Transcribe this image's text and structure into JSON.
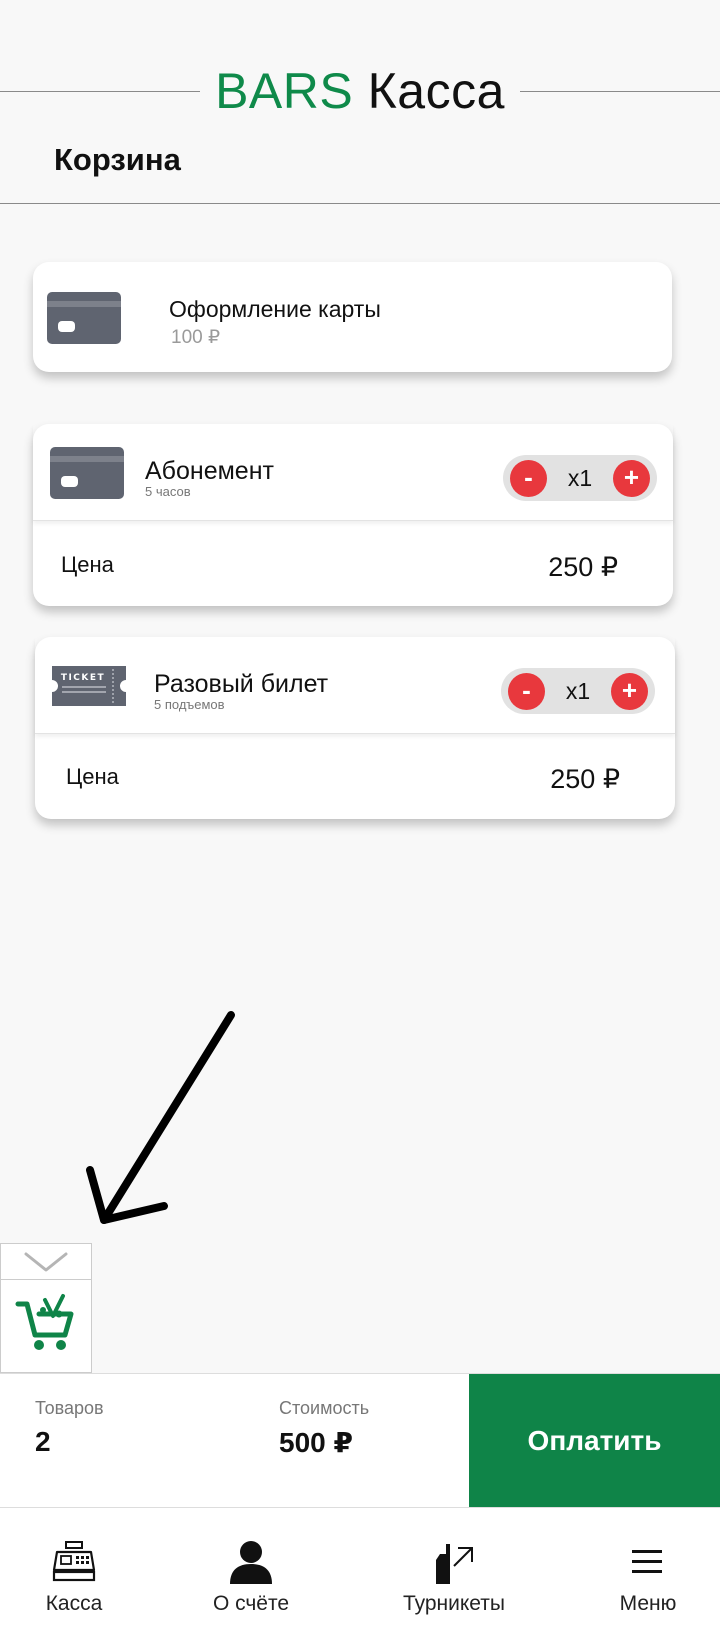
{
  "header": {
    "brand_part1": "BARS",
    "brand_part2": "Касса",
    "page_title": "Корзина"
  },
  "cart": {
    "items": [
      {
        "name": "Оформление карты",
        "subtitle": "100 ₽",
        "icon": "card-icon"
      },
      {
        "name": "Абонемент",
        "subtitle": "5 часов",
        "icon": "card-icon",
        "minus": "-",
        "plus": "+",
        "quantity": "x1",
        "price_label": "Цена",
        "price": "250 ₽"
      },
      {
        "name": "Разовый билет",
        "subtitle": "5 подъемов",
        "icon": "ticket-icon",
        "ticket_text": "TICKET",
        "minus": "-",
        "plus": "+",
        "quantity": "x1",
        "price_label": "Цена",
        "price": "250 ₽"
      }
    ]
  },
  "summary": {
    "items_label": "Товаров",
    "items_value": "2",
    "cost_label": "Стоимость",
    "cost_value": "500 ₽",
    "pay_label": "Оплатить"
  },
  "nav": {
    "items": [
      {
        "label": "Касса",
        "icon": "cash-register-icon"
      },
      {
        "label": "О счёте",
        "icon": "user-icon"
      },
      {
        "label": "Турникеты",
        "icon": "turnstile-icon"
      },
      {
        "label": "Меню",
        "icon": "menu-icon"
      }
    ]
  },
  "colors": {
    "brand_green": "#0f8448",
    "accent_red": "#e8383d",
    "icon_gray": "#5f6470"
  }
}
